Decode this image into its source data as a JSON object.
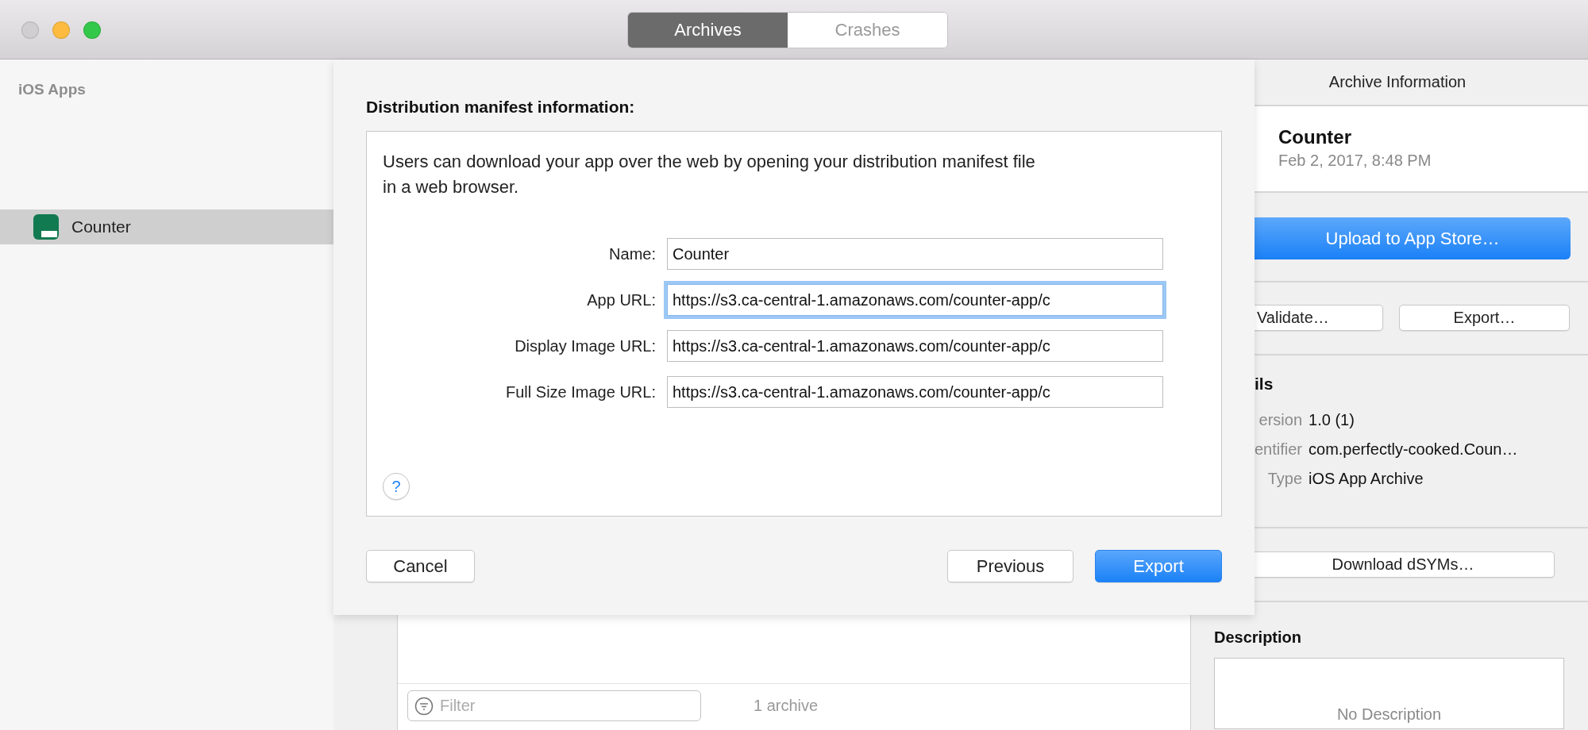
{
  "window": {
    "traffic_lights": [
      {
        "color": "#d0ced0"
      },
      {
        "color": "#fdbc40"
      },
      {
        "color": "#34c84a"
      }
    ]
  },
  "tabs": [
    {
      "label": "Archives",
      "selected": true
    },
    {
      "label": "Crashes",
      "selected": false
    }
  ],
  "sidebar": {
    "heading": "iOS Apps",
    "items": [
      {
        "label": "Counter",
        "selected": true
      }
    ]
  },
  "sheet": {
    "title": "Distribution manifest information:",
    "message": "Users can download your app over the web by opening your distribution manifest file in a web browser.",
    "fields": [
      {
        "label": "Name:",
        "value": "Counter",
        "focused": false
      },
      {
        "label": "App URL:",
        "value": "https://s3.ca-central-1.amazonaws.com/counter-app/c",
        "focused": true
      },
      {
        "label": "Display Image URL:",
        "value": "https://s3.ca-central-1.amazonaws.com/counter-app/c",
        "focused": false
      },
      {
        "label": "Full Size Image URL:",
        "value": "https://s3.ca-central-1.amazonaws.com/counter-app/c",
        "focused": false
      }
    ],
    "help_button": "?",
    "buttons": [
      {
        "label": "Cancel",
        "kind": "plain"
      },
      {
        "label": "Previous",
        "kind": "plain"
      },
      {
        "label": "Export",
        "kind": "primary"
      }
    ]
  },
  "archive_list": {
    "filter": {
      "placeholder": "Filter"
    },
    "count": "1 archive"
  },
  "archive_info": {
    "heading": "Archive Information",
    "name": "Counter",
    "date": "Feb 2, 2017, 8:48 PM",
    "upload_button": "Upload to App Store…",
    "buttons": [
      "Validate…",
      "Export…"
    ],
    "details_heading": "ils",
    "details": [
      {
        "label": "ersion",
        "value": "1.0 (1)"
      },
      {
        "label": "entifier",
        "value": "com.perfectly-cooked.Coun…"
      },
      {
        "label": "Type",
        "value": "iOS App Archive"
      }
    ],
    "dsyms_button": "Download dSYMs…",
    "description_heading": "Description",
    "description_placeholder": "No Description"
  }
}
